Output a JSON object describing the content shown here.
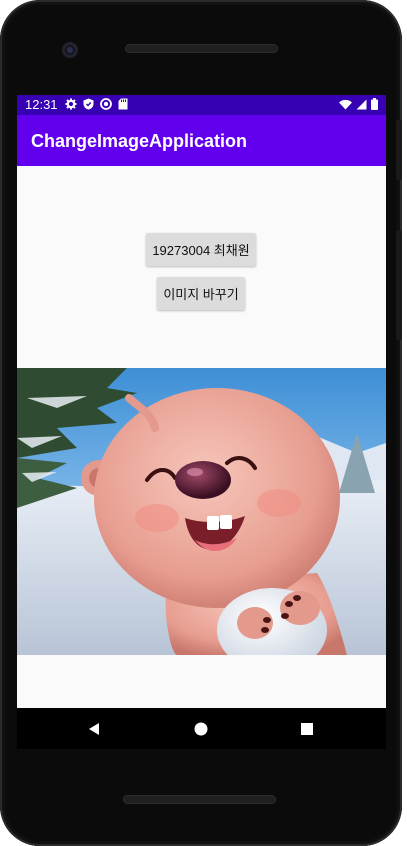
{
  "status_bar": {
    "time": "12:31",
    "left_icons": [
      "settings-icon",
      "shield-icon",
      "circle-badge-icon",
      "sd-card-icon"
    ],
    "right_icons": [
      "wifi-icon",
      "signal-icon",
      "battery-icon"
    ]
  },
  "app_bar": {
    "title": "ChangeImageApplication"
  },
  "content": {
    "name_button_label": "19273004 최채원",
    "change_button_label": "이미지 바꾸기",
    "image": "cartoon-beaver-character-in-snow"
  },
  "nav_bar": {
    "icons": [
      "back-icon",
      "home-icon",
      "recents-icon"
    ]
  },
  "colors": {
    "status_bar": "#3700b3",
    "app_bar": "#6200ee",
    "content_bg": "#fafafa",
    "button_bg": "#dcdcdc"
  }
}
